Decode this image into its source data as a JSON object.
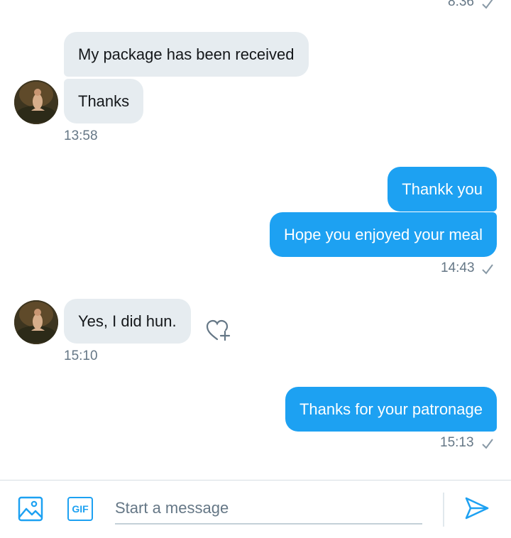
{
  "messages": [
    {
      "direction": "out",
      "time": "8:36"
    },
    {
      "direction": "in",
      "texts": [
        "My package has been received",
        "Thanks"
      ],
      "time": "13:58"
    },
    {
      "direction": "out",
      "texts": [
        "Thankk you",
        "Hope you enjoyed your meal"
      ],
      "time": "14:43"
    },
    {
      "direction": "in",
      "texts": [
        "Yes, I did hun."
      ],
      "time": "15:10"
    },
    {
      "direction": "out",
      "texts": [
        "Thanks for your patronage"
      ],
      "time": "15:13"
    }
  ],
  "composer": {
    "placeholder": "Start a message",
    "gif_label": "GIF"
  },
  "icons": {
    "media": "image-icon",
    "gif": "gif-icon",
    "send": "send-icon",
    "react": "heart-add-icon",
    "read": "check-icon"
  },
  "colors": {
    "accent": "#1da1f2",
    "incoming_bubble": "#e6ecf0",
    "meta_text": "#657786"
  }
}
